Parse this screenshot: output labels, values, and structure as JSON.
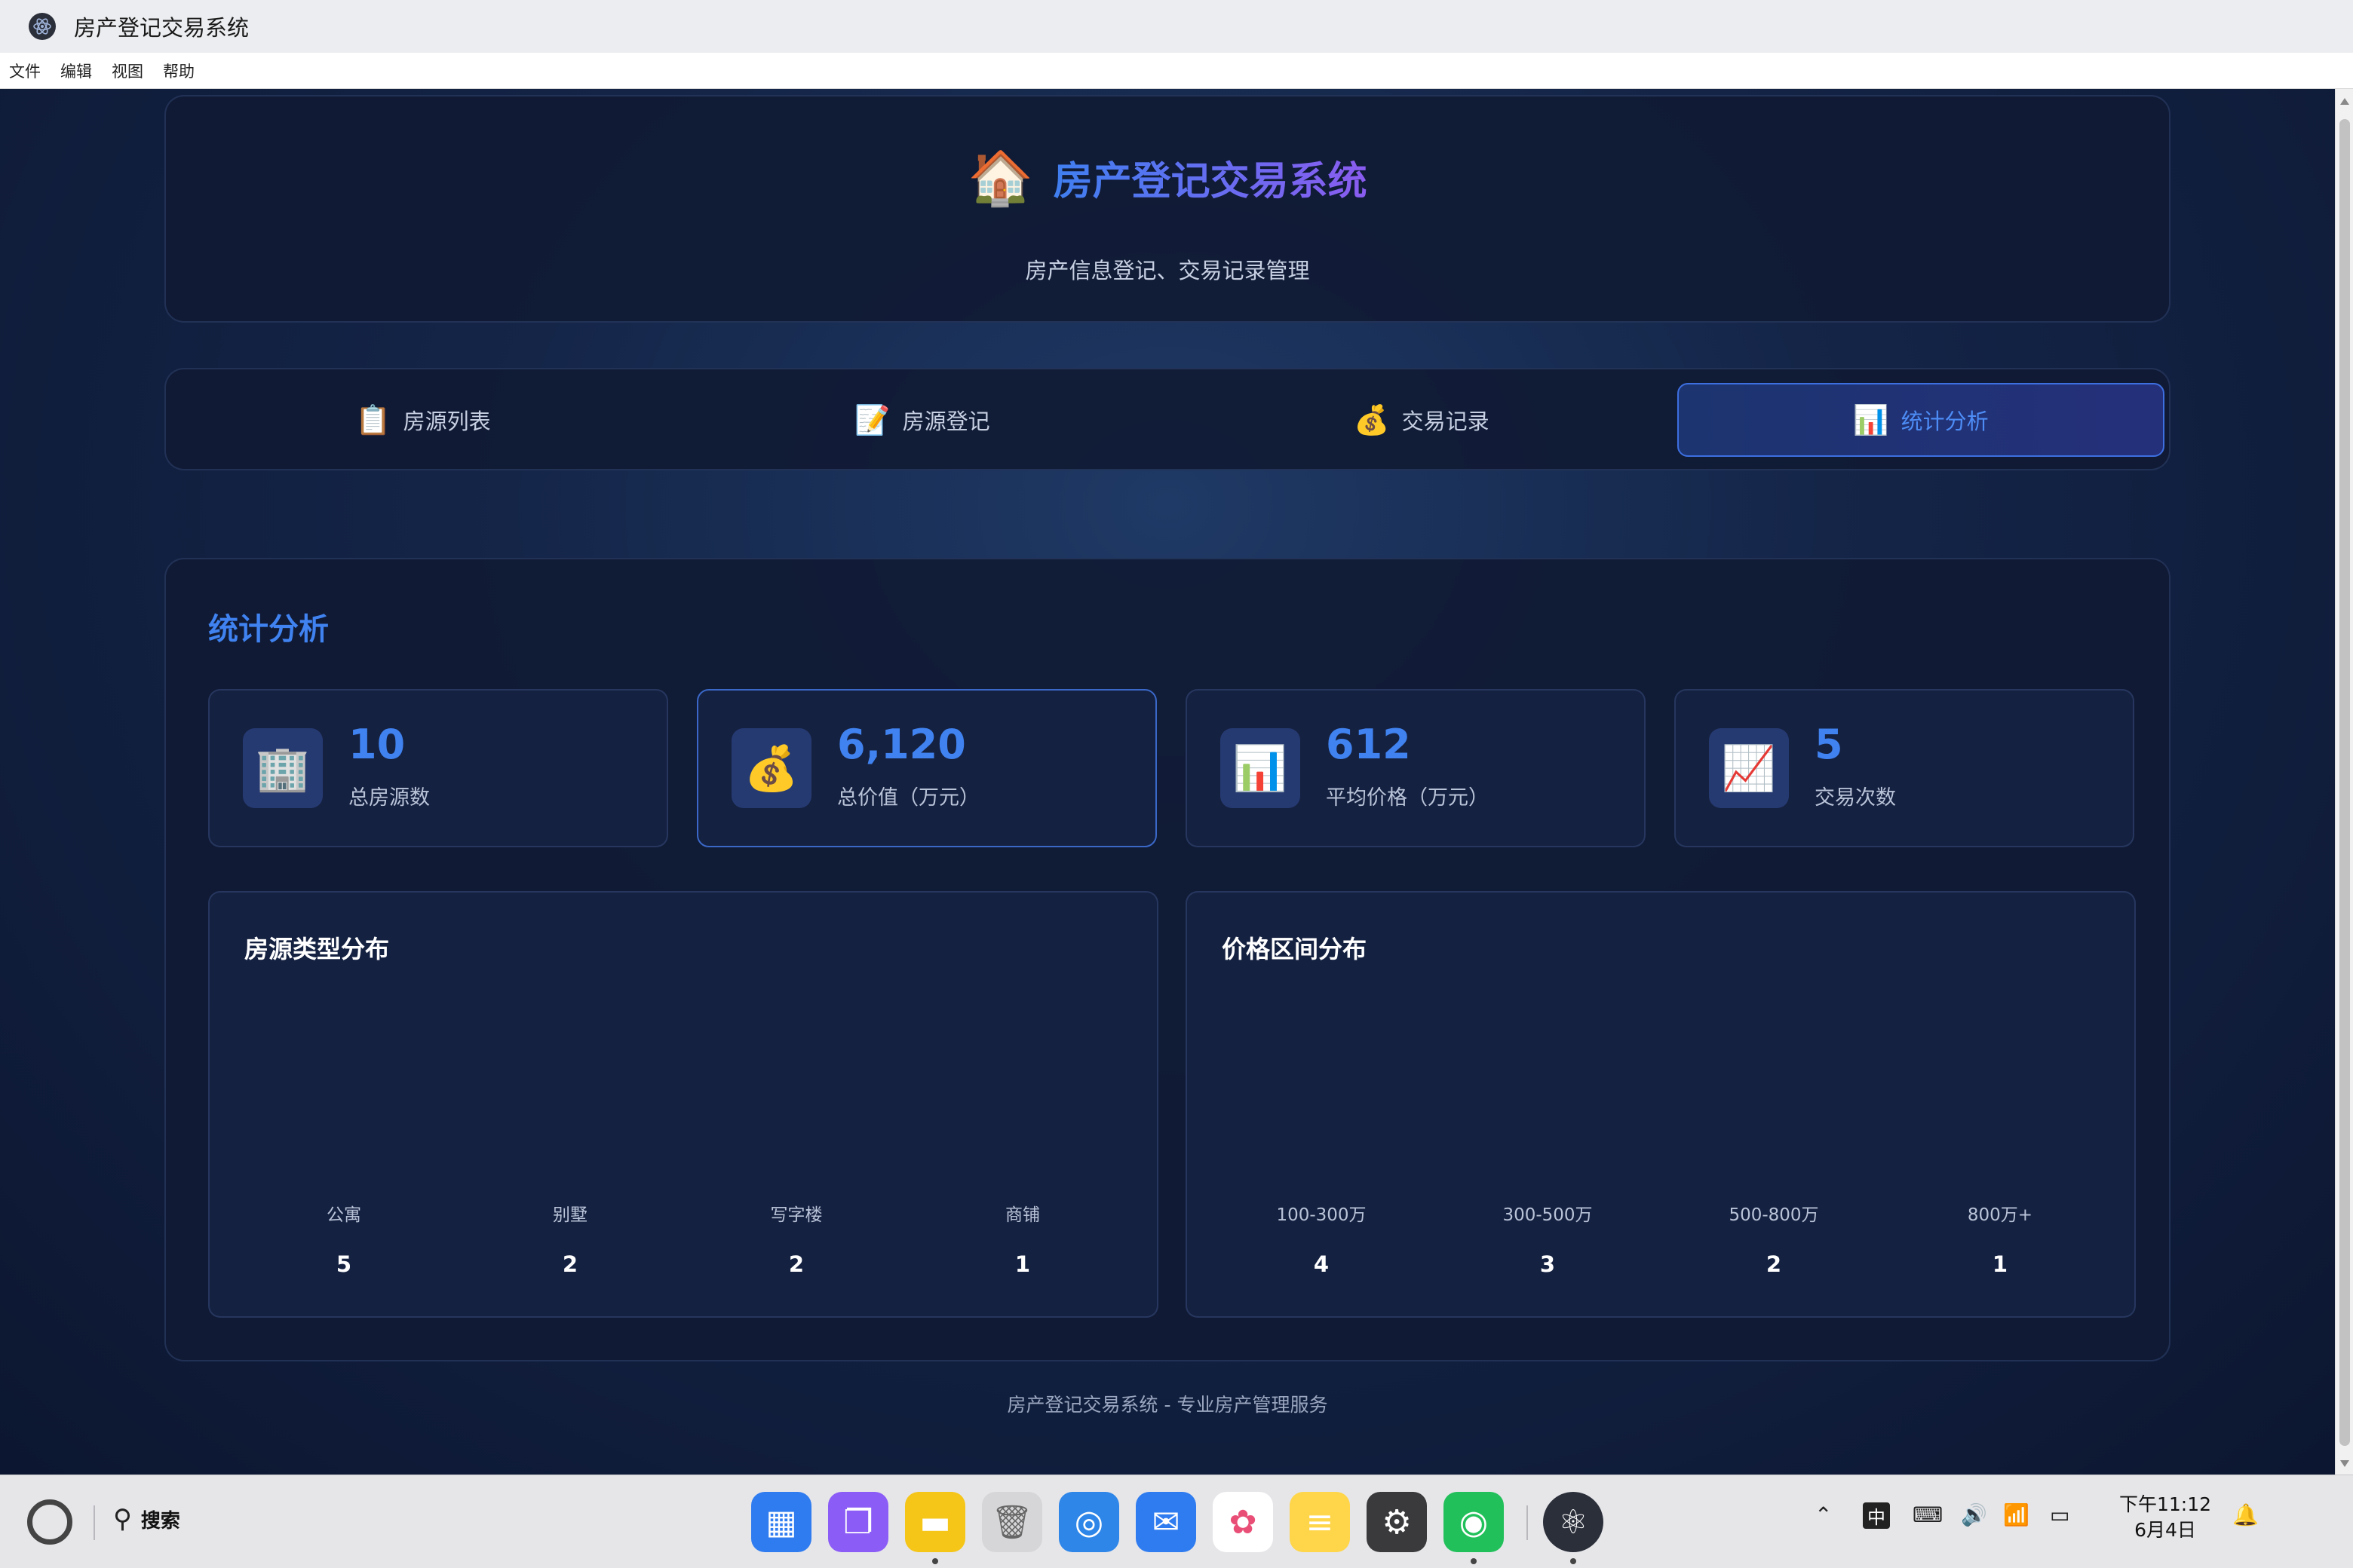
{
  "window": {
    "title": "房产登记交易系统"
  },
  "menu": [
    "文件",
    "编辑",
    "视图",
    "帮助"
  ],
  "header": {
    "icon": "house-icon",
    "title": "房产登记交易系统",
    "subtitle": "房产信息登记、交易记录管理"
  },
  "tabs": [
    {
      "label": "房源列表",
      "icon": "clipboard-icon",
      "active": false
    },
    {
      "label": "房源登记",
      "icon": "memo-icon",
      "active": false
    },
    {
      "label": "交易记录",
      "icon": "money-bag-icon",
      "active": false
    },
    {
      "label": "统计分析",
      "icon": "bar-chart-icon",
      "active": true
    }
  ],
  "stats_section": {
    "title": "统计分析",
    "cards": [
      {
        "value": "10",
        "label": "总房源数",
        "icon": "office-building-icon",
        "highlight": false
      },
      {
        "value": "6,120",
        "label": "总价值（万元）",
        "icon": "money-bag-icon",
        "highlight": true
      },
      {
        "value": "612",
        "label": "平均价格（万元）",
        "icon": "bar-chart-icon",
        "highlight": false
      },
      {
        "value": "5",
        "label": "交易次数",
        "icon": "chart-increasing-icon",
        "highlight": false
      }
    ]
  },
  "charts": {
    "type_distribution": {
      "title": "房源类型分布",
      "categories": [
        "公寓",
        "别墅",
        "写字楼",
        "商铺"
      ],
      "values": [
        "5",
        "2",
        "2",
        "1"
      ]
    },
    "price_distribution": {
      "title": "价格区间分布",
      "categories": [
        "100-300万",
        "300-500万",
        "500-800万",
        "800万+"
      ],
      "values": [
        "4",
        "3",
        "2",
        "1"
      ]
    }
  },
  "footer": {
    "text": "房产登记交易系统 - 专业房产管理服务"
  },
  "taskbar": {
    "search_label": "搜索",
    "apps": [
      "launcher-icon",
      "multitask-icon",
      "files-icon",
      "trash-icon",
      "browser-icon",
      "mail-icon",
      "photos-icon",
      "notes-icon",
      "settings-icon",
      "wechat-icon",
      "electron-app-icon"
    ],
    "tray": {
      "ime": "中",
      "time": "下午11:12",
      "date": "6月4日"
    }
  },
  "colors": {
    "accent": "#3f82f0",
    "title_gradient_start": "#3f7ff0",
    "title_gradient_end": "#8a5cf0",
    "background": "#142548"
  }
}
